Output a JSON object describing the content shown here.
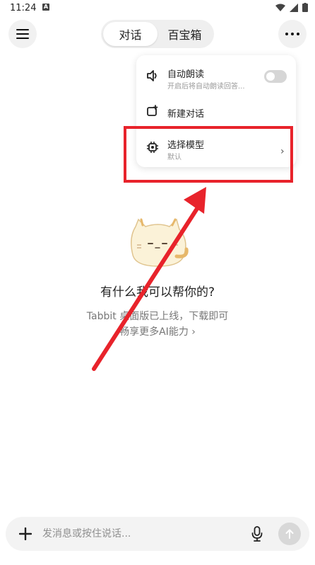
{
  "status_bar": {
    "time": "11:24",
    "a_icon": "A"
  },
  "header": {
    "tabs": [
      {
        "label": "对话",
        "active": true
      },
      {
        "label": "百宝箱",
        "active": false
      }
    ],
    "menu_icon": "hamburger-icon",
    "more_icon": "more-horizontal-icon"
  },
  "dropdown": {
    "items": [
      {
        "title": "自动朗读",
        "subtitle": "开启后将自动朗读回答...",
        "icon": "speaker-icon",
        "toggle": false
      },
      {
        "title": "新建对话",
        "icon": "new-chat-icon"
      },
      {
        "title": "选择模型",
        "subtitle": "默认",
        "icon": "chip-icon",
        "chevron": "›"
      }
    ]
  },
  "main": {
    "prompt": "有什么我可以帮你的?",
    "promo_line1": "Tabbit 桌面版已上线，下载即可",
    "promo_line2": "畅享更多AI能力 ›"
  },
  "input": {
    "placeholder": "发消息或按住说话..."
  },
  "colors": {
    "highlight": "#e8232b",
    "arrow": "#e8232b"
  }
}
